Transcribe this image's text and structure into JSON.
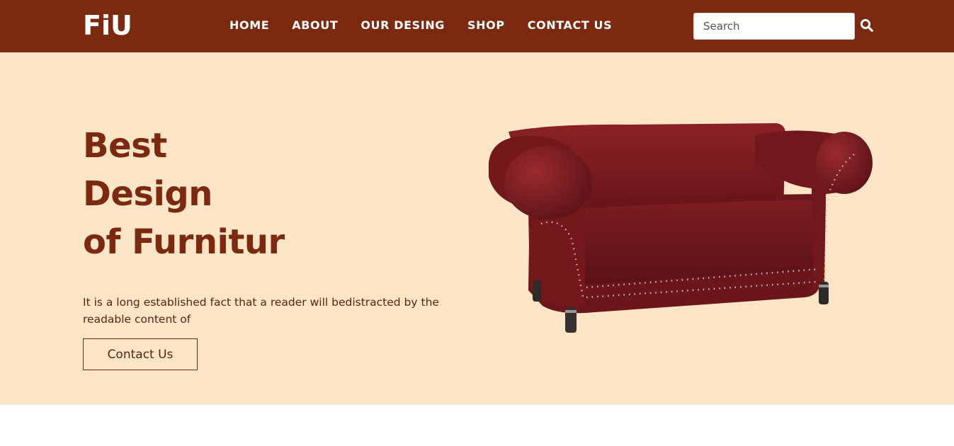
{
  "header": {
    "logo": "FiU",
    "nav": [
      "HOME",
      "ABOUT",
      "OUR DESING",
      "SHOP",
      "CONTACT US"
    ],
    "search": {
      "placeholder": "Search"
    },
    "icons": {
      "search": "search-icon"
    }
  },
  "hero": {
    "title_lines": [
      "Best",
      "Design",
      "of Furnitur"
    ],
    "description": "It is a long established fact that a reader will bedistracted by the readable content of",
    "button_label": "Contact Us",
    "image": "sofa-image"
  },
  "colors": {
    "brand": "#7b2a10",
    "hero_background": "#fbe5c6",
    "sofa": "#7a1a1d"
  }
}
